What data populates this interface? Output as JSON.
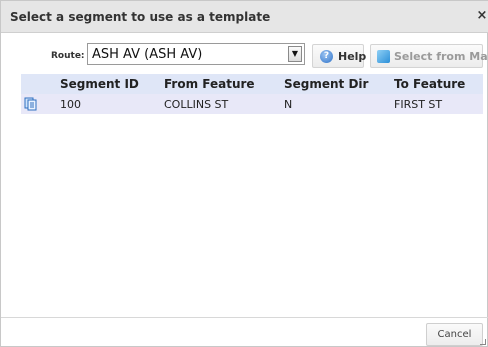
{
  "dialog": {
    "title": "Select a segment to use as a template",
    "close_glyph": "×"
  },
  "route": {
    "label": "Route:",
    "selected": "ASH AV (ASH AV)",
    "arrow_glyph": "▼"
  },
  "toolbar": {
    "help_label": "Help",
    "help_icon_glyph": "?",
    "select_from_map_label": "Select from Map"
  },
  "table": {
    "columns": [
      "Segment ID",
      "From Feature",
      "Segment Dir",
      "To Feature"
    ],
    "rows": [
      {
        "segment_id": "100",
        "from_feature": "COLLINS ST",
        "segment_dir": "N",
        "to_feature": "FIRST ST"
      }
    ]
  },
  "footer": {
    "cancel_label": "Cancel"
  },
  "colors": {
    "titlebar_bg": "#e6e6e6",
    "header_row_bg": "#dfe6f7",
    "data_row_bg": "#e8e8f8",
    "disabled_text": "#9a9a9a",
    "accent_blue": "#2f73c9"
  },
  "icons": {
    "help": "help-circle-icon",
    "map": "map-icon",
    "row_select": "copy-document-icon",
    "close": "close-icon",
    "dropdown": "chevron-down-icon",
    "resize": "resize-grip-icon"
  }
}
